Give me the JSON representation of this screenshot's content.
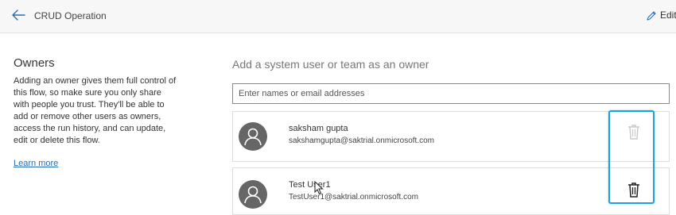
{
  "header": {
    "title": "CRUD Operation",
    "back_icon": "arrow-left-icon",
    "edit_label": "Edit",
    "edit_icon": "pencil-icon",
    "accent_color": "#2b6cb0"
  },
  "owners_section": {
    "heading": "Owners",
    "description": "Adding an owner gives them full control of this flow, so make sure you only share with people you trust. They'll be able to add or remove other users as owners, access the run history, and can update, edit or delete this flow.",
    "learn_more_label": "Learn more"
  },
  "add_owner": {
    "heading": "Add a system user or team as an owner",
    "search_placeholder": "Enter names or email addresses",
    "search_value": ""
  },
  "owners": [
    {
      "name": "saksham gupta",
      "email": "sakshamgupta@saktrial.onmicrosoft.com",
      "avatar_icon": "person-icon",
      "delete_icon": "trash-icon",
      "delete_enabled": false
    },
    {
      "name": "Test User1",
      "email": "TestUser1@saktrial.onmicrosoft.com",
      "avatar_icon": "person-icon",
      "delete_icon": "trash-icon",
      "delete_enabled": true
    }
  ],
  "highlight_color": "#1ea1e0"
}
